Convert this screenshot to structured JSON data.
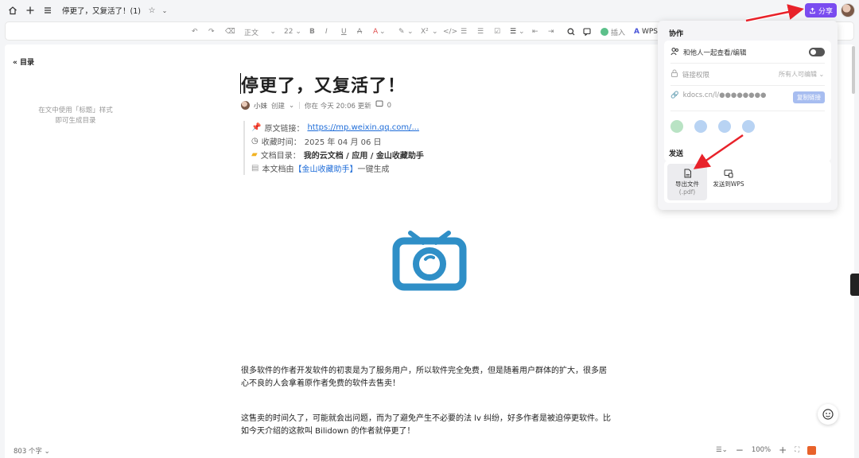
{
  "topbar": {
    "doc_title": "停更了，又复活了！(1)",
    "share_label": "分享"
  },
  "toolbar": {
    "style_label": "正文",
    "size_label": "22",
    "insert_label": "插入",
    "wps_label": "WPS"
  },
  "toc": {
    "title": "目录",
    "hint_line1": "在文中使用「标题」样式",
    "hint_line2": "即可生成目录"
  },
  "doc": {
    "heading": "停更了，又复活了！",
    "author": "小妹",
    "created": "创建",
    "updated": "你在 今天 20:06 更新",
    "comments": "0",
    "quote": {
      "link_label": "原文链接：",
      "link_value": "https://mp.weixin.qq.com/...",
      "time_label": "收藏时间：",
      "time_value": "2025 年 04 月 06 日",
      "dir_label": "文档目录：",
      "dir_value": "我的云文档 / 应用 / 金山收藏助手",
      "gen_prefix": "本文档由",
      "gen_name": "【金山收藏助手】",
      "gen_suffix": "一键生成"
    },
    "para1_line1": "很多软件的作者开发软件的初衷是为了服务用户，所以软件完全免费，但是随着用户群体的扩大，很多居",
    "para1_line2": "心不良的人会拿着原作者免费的软件去售卖！",
    "para2_line1": "这售卖的时间久了，可能就会出问题，而为了避免产生不必要的法 lv 纠纷，好多作者是被迫停更软件。比",
    "para2_line2": "如今天介绍的这款叫 Bilidown 的作者就停更了！"
  },
  "status": {
    "word_count": "803 个字",
    "zoom": "100%"
  },
  "share_panel": {
    "collab_title": "协作",
    "collab_toggle_label": "和他人一起查看/编辑",
    "link_perm_label": "链接权限",
    "link_perm_value": "所有人可编辑",
    "link_url": "kdocs.cn/l/●●●●●●●●",
    "copy_link": "复制链接",
    "send_title": "发送",
    "export_line1": "导出文件",
    "export_line2": "(.pdf)",
    "send_wps": "发送到WPS"
  },
  "colors": {
    "accent": "#7a4cf0",
    "link": "#1e6cd8",
    "arrow": "#e8222a",
    "tv_blue": "#2f8fc7"
  }
}
